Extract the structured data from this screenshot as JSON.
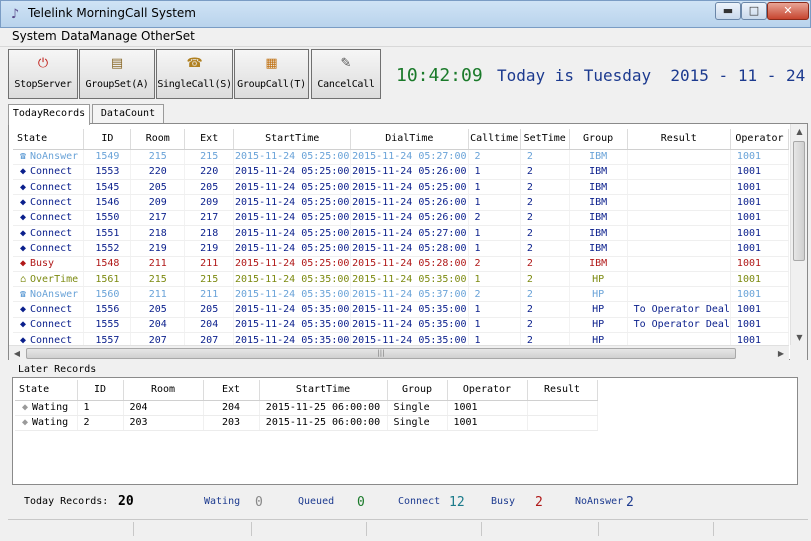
{
  "window": {
    "title": "Telelink MorningCall System",
    "min": "▬",
    "max": "□",
    "close": "✕"
  },
  "menu": [
    "System",
    "DataManage",
    "OtherSet"
  ],
  "toolbar": [
    {
      "label": "StopServer",
      "icon": "power-icon"
    },
    {
      "label": "GroupSet(A)",
      "icon": "group-set-icon"
    },
    {
      "label": "SingleCall(S)",
      "icon": "single-call-icon"
    },
    {
      "label": "GroupCall(T)",
      "icon": "group-call-icon"
    },
    {
      "label": "CancelCall",
      "icon": "cancel-call-icon"
    }
  ],
  "clock": "10:42:09",
  "date_text": "Today is Tuesday  2015 - 11 - 24",
  "tabs": [
    "TodayRecords",
    "DataCount"
  ],
  "today": {
    "columns": [
      "State",
      "ID",
      "Room",
      "Ext",
      "StartTime",
      "DialTime",
      "Calltime",
      "SetTime",
      "Group",
      "Result",
      "Operator"
    ],
    "rows": [
      [
        "NoAnswer",
        "1549",
        "215",
        "215",
        "2015-11-24 05:25:00",
        "2015-11-24 05:27:00",
        "2",
        "2",
        "IBM",
        "",
        "1001"
      ],
      [
        "Connect",
        "1553",
        "220",
        "220",
        "2015-11-24 05:25:00",
        "2015-11-24 05:26:00",
        "1",
        "2",
        "IBM",
        "",
        "1001"
      ],
      [
        "Connect",
        "1545",
        "205",
        "205",
        "2015-11-24 05:25:00",
        "2015-11-24 05:25:00",
        "1",
        "2",
        "IBM",
        "",
        "1001"
      ],
      [
        "Connect",
        "1546",
        "209",
        "209",
        "2015-11-24 05:25:00",
        "2015-11-24 05:26:00",
        "1",
        "2",
        "IBM",
        "",
        "1001"
      ],
      [
        "Connect",
        "1550",
        "217",
        "217",
        "2015-11-24 05:25:00",
        "2015-11-24 05:26:00",
        "2",
        "2",
        "IBM",
        "",
        "1001"
      ],
      [
        "Connect",
        "1551",
        "218",
        "218",
        "2015-11-24 05:25:00",
        "2015-11-24 05:27:00",
        "1",
        "2",
        "IBM",
        "",
        "1001"
      ],
      [
        "Connect",
        "1552",
        "219",
        "219",
        "2015-11-24 05:25:00",
        "2015-11-24 05:28:00",
        "1",
        "2",
        "IBM",
        "",
        "1001"
      ],
      [
        "Busy",
        "1548",
        "211",
        "211",
        "2015-11-24 05:25:00",
        "2015-11-24 05:28:00",
        "2",
        "2",
        "IBM",
        "",
        "1001"
      ],
      [
        "OverTime",
        "1561",
        "215",
        "215",
        "2015-11-24 05:35:00",
        "2015-11-24 05:35:00",
        "1",
        "2",
        "HP",
        "",
        "1001"
      ],
      [
        "NoAnswer",
        "1560",
        "211",
        "211",
        "2015-11-24 05:35:00",
        "2015-11-24 05:37:00",
        "2",
        "2",
        "HP",
        "",
        "1001"
      ],
      [
        "Connect",
        "1556",
        "205",
        "205",
        "2015-11-24 05:35:00",
        "2015-11-24 05:35:00",
        "1",
        "2",
        "HP",
        "To Operator Deal",
        "1001"
      ],
      [
        "Connect",
        "1555",
        "204",
        "204",
        "2015-11-24 05:35:00",
        "2015-11-24 05:35:00",
        "1",
        "2",
        "HP",
        "To Operator Deal",
        "1001"
      ],
      [
        "Connect",
        "1557",
        "207",
        "207",
        "2015-11-24 05:35:00",
        "2015-11-24 05:35:00",
        "1",
        "2",
        "HP",
        "",
        "1001"
      ]
    ]
  },
  "later": {
    "title": "Later Records",
    "columns": [
      "State",
      "ID",
      "Room",
      "Ext",
      "StartTime",
      "Group",
      "Operator",
      "Result"
    ],
    "rows": [
      [
        "Wating",
        "1",
        "204",
        "204",
        "2015-11-25 06:00:00",
        "Single",
        "1001",
        ""
      ],
      [
        "Wating",
        "2",
        "203",
        "203",
        "2015-11-25 06:00:00",
        "Single",
        "1001",
        ""
      ]
    ]
  },
  "stats": {
    "today_label": "Today Records:",
    "today_value": "20",
    "wating_label": "Wating",
    "wating_value": "0",
    "queued_label": "Queued",
    "queued_value": "0",
    "connect_label": "Connect",
    "connect_value": "12",
    "busy_label": "Busy",
    "busy_value": "2",
    "noanswer_label": "NoAnswer",
    "noanswer_value": "2"
  },
  "colors": {
    "NoAnswer": "#6aa3d8",
    "Connect": "#0a1f8c",
    "Busy": "#b01818",
    "OverTime": "#7c8a10",
    "Wating": "#000000",
    "clock": "#1a7a2a",
    "date": "#1c3a8f"
  }
}
